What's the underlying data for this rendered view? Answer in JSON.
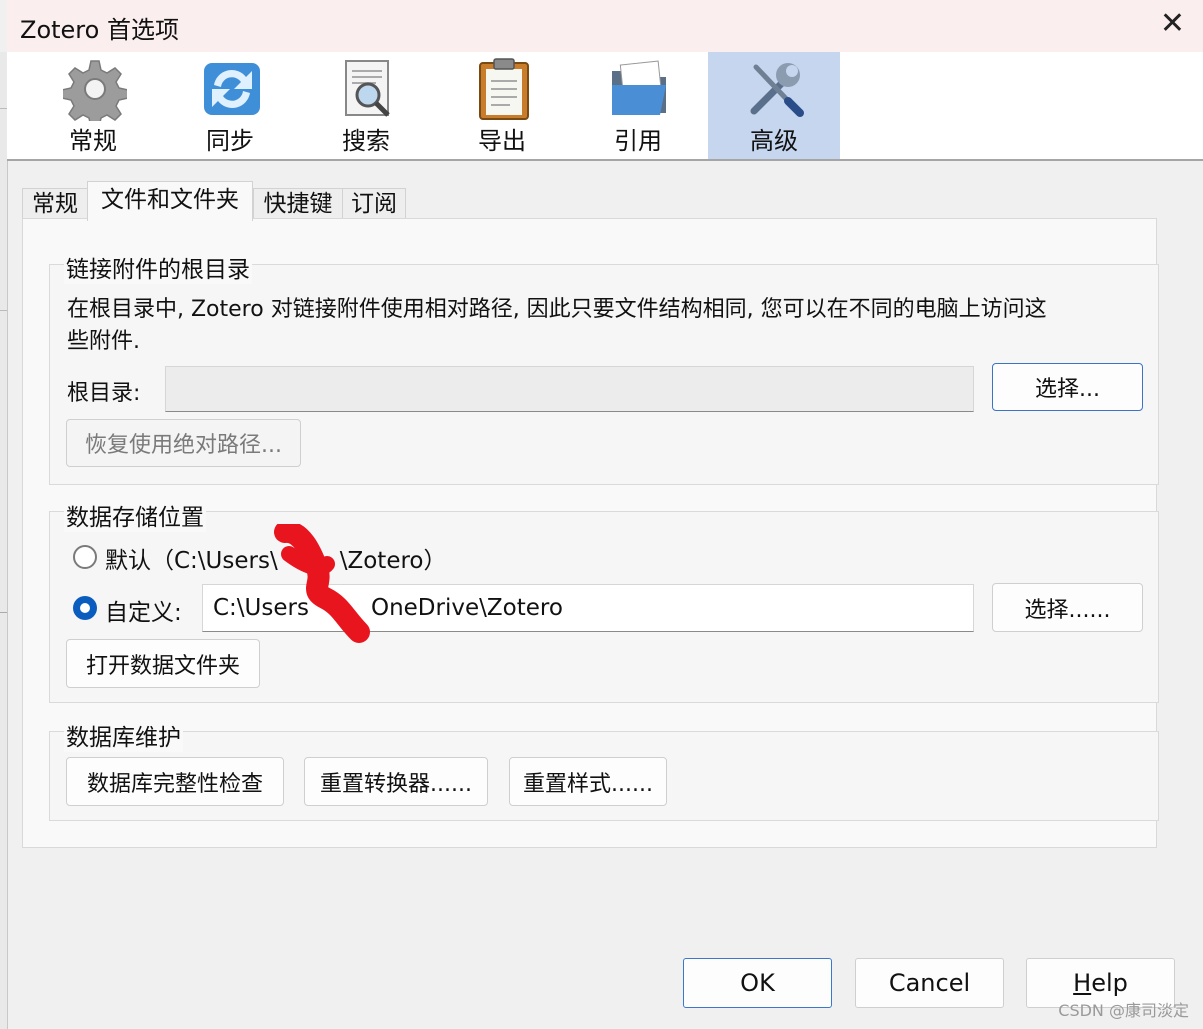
{
  "window": {
    "title": "Zotero 首选项",
    "close_symbol": "✕"
  },
  "toolbar": {
    "items": [
      {
        "label": "常规",
        "icon": "gear-icon"
      },
      {
        "label": "同步",
        "icon": "sync-icon"
      },
      {
        "label": "搜索",
        "icon": "search-icon"
      },
      {
        "label": "导出",
        "icon": "clipboard-icon"
      },
      {
        "label": "引用",
        "icon": "folder-icon"
      },
      {
        "label": "高级",
        "icon": "tools-icon",
        "active": true
      }
    ]
  },
  "tabs": [
    {
      "label": "常规"
    },
    {
      "label": "文件和文件夹",
      "active": true
    },
    {
      "label": "快捷键"
    },
    {
      "label": "订阅"
    }
  ],
  "linked_root": {
    "legend": "链接附件的根目录",
    "description_line1": "在根目录中, Zotero 对链接附件使用相对路径, 因此只要文件结构相同, 您可以在不同的电脑上访问这",
    "description_line2": "些附件.",
    "root_label": "根目录:",
    "root_value": "",
    "choose_button": "选择...",
    "revert_button": "恢复使用绝对路径..."
  },
  "data_location": {
    "legend": "数据存储位置",
    "default_option": "默认（C:\\Users\\",
    "default_option_tail": "\\Zotero）",
    "default_selected": false,
    "custom_option": "自定义:",
    "custom_selected": true,
    "custom_path_start": "C:\\Users",
    "custom_path_end": "OneDrive\\Zotero",
    "choose_button": "选择......",
    "open_folder_button": "打开数据文件夹"
  },
  "db_maintenance": {
    "legend": "数据库维护",
    "integrity_button": "数据库完整性检查",
    "reset_translators_button": "重置转换器......",
    "reset_styles_button": "重置样式......"
  },
  "footer": {
    "ok": "OK",
    "cancel": "Cancel",
    "help_first": "H",
    "help_rest": "elp"
  },
  "watermark": "CSDN @康司淡定",
  "colors": {
    "accent": "#0b5cbf",
    "active_toolbar": "#c5d6ee",
    "redaction": "#e8151e"
  }
}
